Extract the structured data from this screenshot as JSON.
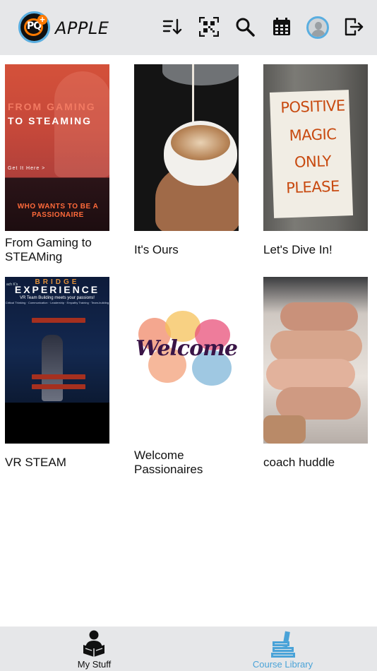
{
  "header": {
    "app_name": "APPLE",
    "logo_text": "PQ",
    "icons": [
      "sort-icon",
      "qr-code-icon",
      "search-icon",
      "calendar-icon",
      "avatar",
      "logout-icon"
    ]
  },
  "courses": [
    {
      "title": "From Gaming to STEAMing",
      "thumb_text": {
        "line1": "FROM GAMING",
        "line2": "TO STEAMING",
        "cta": "Get It Here >",
        "neon": "WHO WANTS TO BE A PASSIONAIRE"
      }
    },
    {
      "title": "It's Ours"
    },
    {
      "title": "Let's Dive In!",
      "thumb_text": {
        "l1": "POSITIVE",
        "l2": "MAGIC",
        "l3": "ONLY",
        "l4": "PLEASE"
      }
    },
    {
      "title": "VR STEAM",
      "thumb_text": {
        "corner": "ach K's",
        "bridge": "BRIDGE",
        "experience": "EXPERIENCE",
        "tagline": "VR Team Building meets your passions!",
        "list": "Critical Thinking · Communication · Leadership · Empathy Training · Team-building"
      }
    },
    {
      "title": "Welcome Passionaires",
      "thumb_text": {
        "word": "Welcome"
      }
    },
    {
      "title": "coach huddle"
    }
  ],
  "tabbar": {
    "tabs": [
      {
        "label": "My Stuff",
        "active": false
      },
      {
        "label": "Course Library",
        "active": true
      }
    ],
    "active_color": "#4aa3d8",
    "inactive_color": "#111111"
  }
}
